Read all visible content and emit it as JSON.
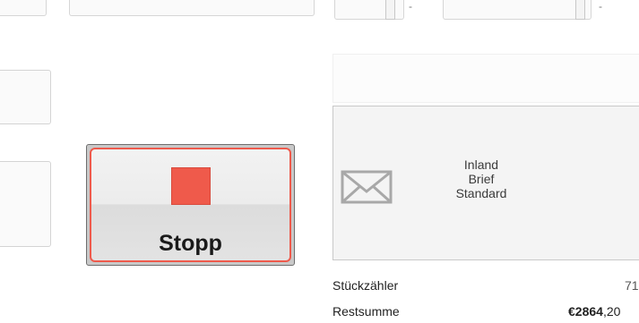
{
  "stop_button": {
    "label": "Stopp",
    "color": "#ef5a4b"
  },
  "card": {
    "lines": [
      "Inland",
      "Brief",
      "Standard"
    ],
    "icon": "envelope-icon"
  },
  "stats": {
    "piece_counter": {
      "label": "Stückzähler",
      "value": "71"
    },
    "remaining_sum": {
      "label": "Restsumme",
      "value_bold": "€2864",
      "value_rest": ",20"
    }
  },
  "top_separators": [
    "-",
    "-"
  ]
}
